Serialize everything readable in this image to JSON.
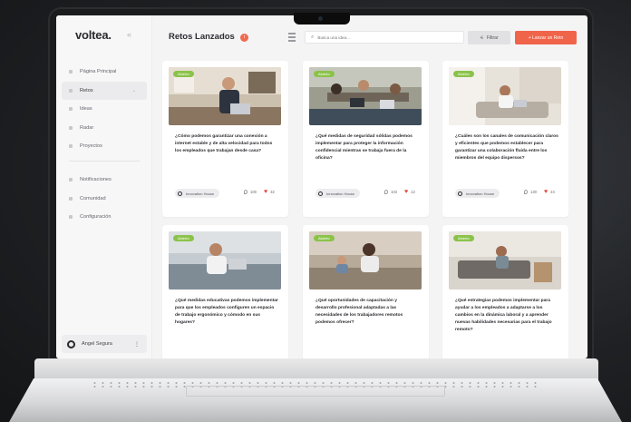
{
  "app": {
    "logo": "voltea.",
    "collapse_icon": "chevrons-left-icon"
  },
  "sidebar": {
    "items": [
      {
        "label": "Página Principal",
        "icon": "home-icon"
      },
      {
        "label": "Retos",
        "icon": "flag-icon",
        "active": true
      },
      {
        "label": "Ideas",
        "icon": "bulb-icon"
      },
      {
        "label": "Radar",
        "icon": "radar-icon"
      },
      {
        "label": "Proyectos",
        "icon": "folder-icon"
      }
    ],
    "items2": [
      {
        "label": "Notificaciones",
        "icon": "bell-icon"
      },
      {
        "label": "Comunidad",
        "icon": "people-icon"
      },
      {
        "label": "Configuración",
        "icon": "gear-icon"
      }
    ],
    "user": {
      "name": "Angel Segura"
    }
  },
  "header": {
    "title": "Retos Lanzados",
    "badge": "i",
    "search_placeholder": "Busca una idea...",
    "filter_label": "Filtrar",
    "launch_label": "+ Lanzar un Reto"
  },
  "cards": [
    {
      "tag": "Abierto",
      "question": "¿Cómo podemos garantizar una conexión a internet estable y de alta velocidad para todos los empleados que trabajan desde casa?",
      "org": "Innovation House",
      "views": "100",
      "likes": "32"
    },
    {
      "tag": "Abierto",
      "question": "¿Qué medidas de seguridad sólidas podemos implementar para proteger la información confidencial mientras se trabaja fuera de la oficina?",
      "org": "Innovation House",
      "views": "103",
      "likes": "12"
    },
    {
      "tag": "Abierto",
      "question": "¿Cuáles son los canales de comunicación claros y eficientes que podemos establecer para garantizar una colaboración fluida entre los miembros del equipo dispersos?",
      "org": "Innovation House",
      "views": "130",
      "likes": "24"
    },
    {
      "tag": "Abierto",
      "question": "¿Qué medidas educativas podemos implementar para que los empleados configuren un espacio de trabajo ergonómico y cómodo en sus hogares?"
    },
    {
      "tag": "Abierto",
      "question": "¿Qué oportunidades de capacitación y desarrollo profesional adaptadas a las necesidades de los trabajadores remotos podemos ofrecer?"
    },
    {
      "tag": "Abierto",
      "question": "¿Qué estrategias podemos implementar para ayudar a los empleados a adaptarse a los cambios en la dinámica laboral y a aprender nuevas habilidades necesarias para el trabajo remoto?"
    }
  ]
}
